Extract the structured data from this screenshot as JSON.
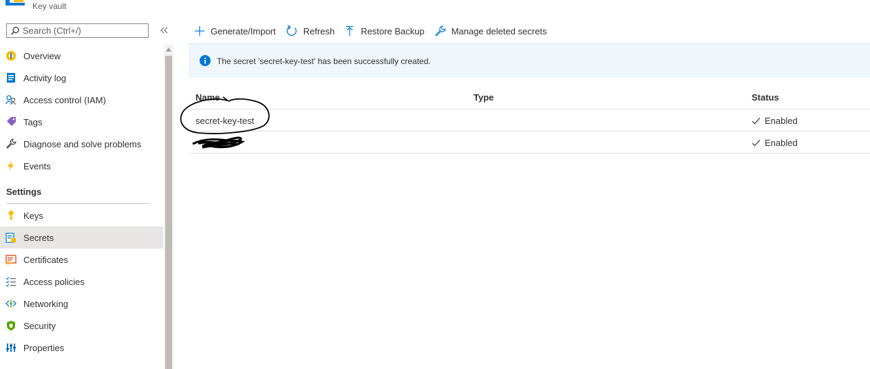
{
  "header": {
    "subtitle": "Key vault"
  },
  "sidebar": {
    "search_placeholder": "Search (Ctrl+/)",
    "items_top": [
      {
        "label": "Overview",
        "icon": "overview-icon"
      },
      {
        "label": "Activity log",
        "icon": "activity-log-icon"
      },
      {
        "label": "Access control (IAM)",
        "icon": "iam-icon"
      },
      {
        "label": "Tags",
        "icon": "tag-icon"
      },
      {
        "label": "Diagnose and solve problems",
        "icon": "wrench-icon"
      },
      {
        "label": "Events",
        "icon": "lightning-icon"
      }
    ],
    "section_label": "Settings",
    "items_settings": [
      {
        "label": "Keys",
        "icon": "key-icon"
      },
      {
        "label": "Secrets",
        "icon": "secrets-icon",
        "selected": true
      },
      {
        "label": "Certificates",
        "icon": "certificate-icon"
      },
      {
        "label": "Access policies",
        "icon": "access-policies-icon"
      },
      {
        "label": "Networking",
        "icon": "networking-icon"
      },
      {
        "label": "Security",
        "icon": "shield-icon"
      },
      {
        "label": "Properties",
        "icon": "properties-icon"
      }
    ]
  },
  "toolbar": {
    "generate_label": "Generate/Import",
    "refresh_label": "Refresh",
    "restore_label": "Restore Backup",
    "manage_deleted_label": "Manage deleted secrets"
  },
  "banner": {
    "message": "The secret 'secret-key-test' has been successfully created."
  },
  "table": {
    "columns": [
      "Name",
      "Type",
      "Status"
    ],
    "rows": [
      {
        "name": "secret-key-test",
        "type": "",
        "status": "Enabled"
      },
      {
        "name": "",
        "type": "",
        "status": "Enabled"
      }
    ]
  },
  "colors": {
    "accent": "#0078d4",
    "selected_bg": "#e8e6e4",
    "banner_bg": "#eff6fc"
  }
}
